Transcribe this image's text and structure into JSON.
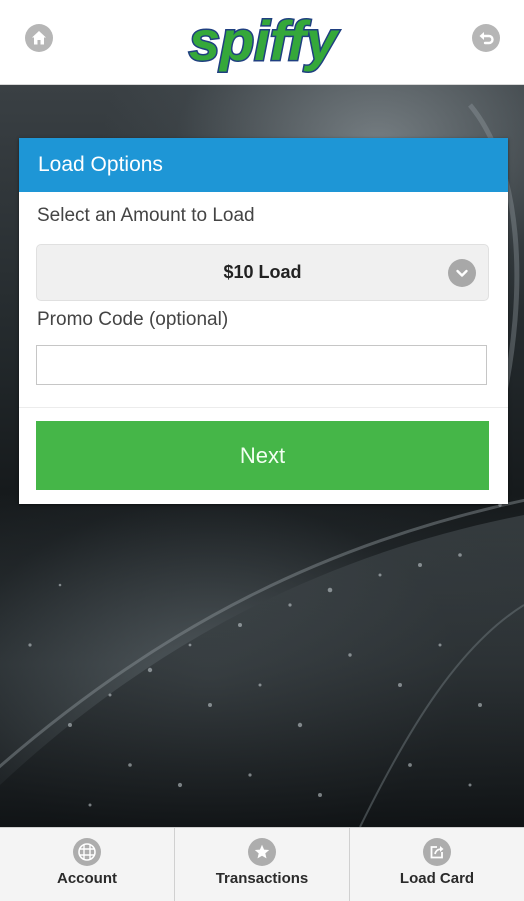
{
  "app": {
    "logo_text": "spiffy",
    "logo_color": "#35a83a",
    "logo_outline_color": "#1f3f80"
  },
  "header": {
    "left_icon": "home-icon",
    "right_icon": "back-icon"
  },
  "card": {
    "title": "Load Options",
    "header_color": "#1e96d6",
    "amount_label": "Select an Amount to Load",
    "amount_value": "$10 Load",
    "promo_label": "Promo Code (optional)",
    "promo_value": "",
    "promo_placeholder": "",
    "next_label": "Next",
    "next_color": "#45b648"
  },
  "tabbar": {
    "items": [
      {
        "label": "Account",
        "icon": "grid-globe-icon"
      },
      {
        "label": "Transactions",
        "icon": "star-icon"
      },
      {
        "label": "Load Card",
        "icon": "share-icon"
      }
    ]
  }
}
